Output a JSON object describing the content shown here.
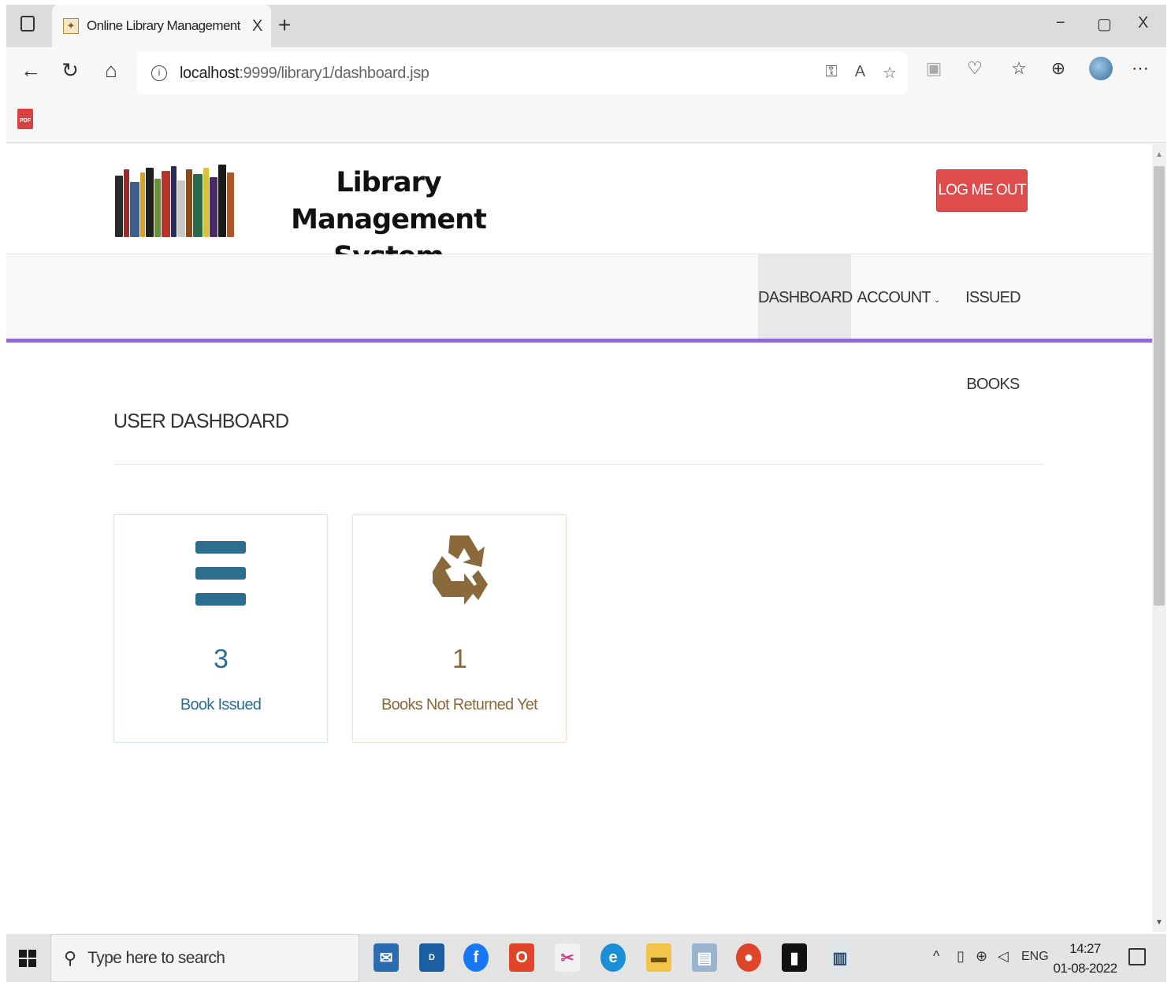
{
  "browser": {
    "tab_title": "Online Library Management System",
    "new_tab": "+",
    "tab_close": "X",
    "url_host": "localhost",
    "url_rest": ":9999/library1/dashboard.jsp",
    "window_controls": {
      "minimize": "−",
      "restore": "▢",
      "close": "X"
    },
    "icons": [
      "tab-switcher-icon",
      "favicon-icon",
      "back-icon",
      "refresh-icon",
      "home-icon",
      "info-icon",
      "password-icon",
      "read-aloud-icon",
      "favorite-add-icon",
      "extension-icon",
      "browser-essentials-icon",
      "favorites-icon",
      "collections-icon",
      "profile-avatar-icon",
      "more-icon",
      "pdf-icon"
    ]
  },
  "header": {
    "brand_line1": "Library Management",
    "brand_line2": "System",
    "logout_label": "LOG ME OUT",
    "logout_color": "#de4c4c"
  },
  "nav": {
    "items": [
      {
        "label": "DASHBOARD",
        "active": true
      },
      {
        "label": "ACCOUNT",
        "dropdown": true
      },
      {
        "label": "ISSUED BOOKS"
      }
    ],
    "underline_color": "#8e6bd6"
  },
  "dashboard": {
    "title": "USER DASHBOARD",
    "cards": [
      {
        "value": "3",
        "label": "Book Issued",
        "icon": "list-bars-icon",
        "color": "#2c6e8f"
      },
      {
        "value": "1",
        "label": "Books Not Returned Yet",
        "icon": "recycle-icon",
        "color": "#8a6a3a"
      }
    ]
  },
  "taskbar": {
    "search_placeholder": "Type here to search",
    "language": "ENG",
    "time": "14:27",
    "date": "01-08-2022",
    "apps": [
      "mail-icon",
      "dell-icon",
      "facebook-icon",
      "office-icon",
      "snip-icon",
      "edge-icon",
      "file-explorer-icon",
      "notepad-icon",
      "chrome-icon",
      "terminal-icon",
      "app-icon"
    ]
  }
}
